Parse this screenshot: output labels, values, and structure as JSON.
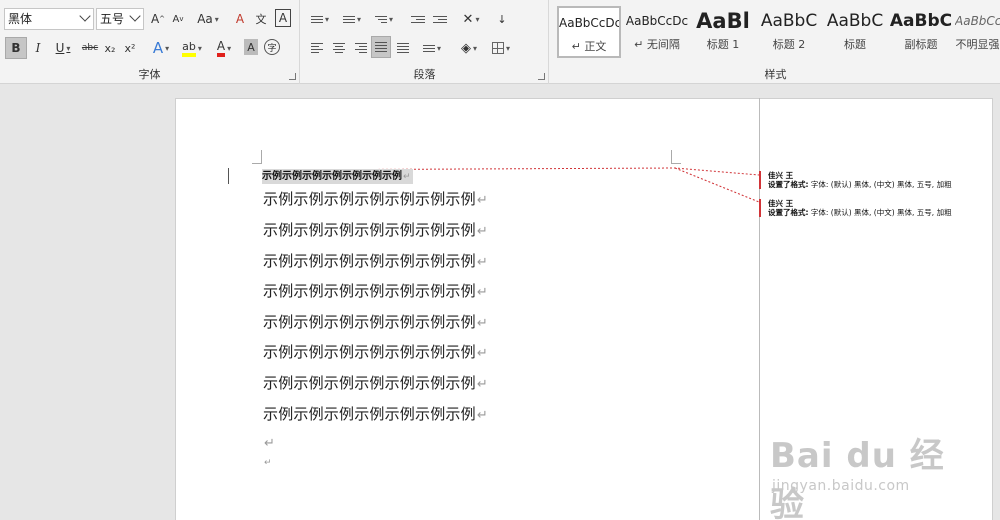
{
  "ribbon": {
    "font_group": {
      "label": "字体",
      "font_name": "黑体",
      "font_size": "五号",
      "grow_font": "A",
      "shrink_font": "A",
      "change_case": "Aa",
      "clear_format": "A",
      "phonetic": "文",
      "char_border": "A",
      "bold": "B",
      "italic": "I",
      "underline": "U",
      "strikethrough": "abc",
      "subscript": "x₂",
      "superscript": "x²",
      "text_effect": "A",
      "highlight": "ab",
      "font_color": "A",
      "char_shading": "A",
      "enclose": "字"
    },
    "paragraph_group": {
      "label": "段落"
    },
    "styles_group": {
      "label": "样式",
      "items": [
        {
          "sample": "AaBbCcDc",
          "name": "↵ 正文"
        },
        {
          "sample": "AaBbCcDc",
          "name": "↵ 无间隔"
        },
        {
          "sample": "AaBl",
          "name": "标题 1"
        },
        {
          "sample": "AaBbC",
          "name": "标题 2"
        },
        {
          "sample": "AaBbC",
          "name": "标题"
        },
        {
          "sample": "AaBbC",
          "name": "副标题"
        },
        {
          "sample": "AaBbCc",
          "name": "不明显强"
        }
      ]
    }
  },
  "document": {
    "first_line": "示例示例示例示例示例示例示例",
    "body_lines": [
      "示例示例示例示例示例示例示例",
      "示例示例示例示例示例示例示例",
      "示例示例示例示例示例示例示例",
      "示例示例示例示例示例示例示例",
      "示例示例示例示例示例示例示例",
      "示例示例示例示例示例示例示例",
      "示例示例示例示例示例示例示例",
      "示例示例示例示例示例示例示例"
    ],
    "para_mark": "↵"
  },
  "balloons": [
    {
      "author": "佳兴 王",
      "label": "设置了格式:",
      "detail": "字体: (默认) 黑体, (中文) 黑体, 五号, 加粗"
    },
    {
      "author": "佳兴 王",
      "label": "设置了格式:",
      "detail": "字体: (默认) 黑体, (中文) 黑体, 五号, 加粗"
    }
  ],
  "watermark": {
    "main": "Bai du 经验",
    "sub": "jingyan.baidu.com"
  },
  "colors": {
    "revision_red": "#d13438",
    "font_color_red": "#e0201b",
    "highlight_yellow": "#ffff00",
    "ribbon_bg": "#f3f3f3"
  }
}
